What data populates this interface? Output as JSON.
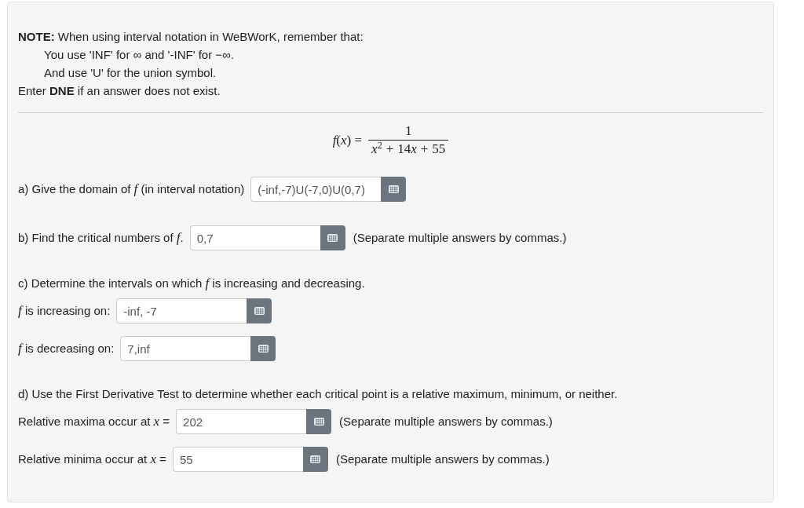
{
  "note": {
    "intro": "**NOTE:** When using interval notation in WeBWorK, remember that:",
    "items": [
      "You use 'INF' for ∞ and '-INF' for −∞.",
      "And use 'U' for the union symbol."
    ],
    "closing": "Enter **DNE** if an answer does not exist."
  },
  "formula": {
    "lhs": "*f*(*x*) =",
    "numerator": "1",
    "denominator": [
      {
        "kind": "variable",
        "text": "x",
        "exponent": "2"
      },
      {
        "kind": "operator",
        "text": "+"
      },
      {
        "kind": "number",
        "text": "14"
      },
      {
        "kind": "variable",
        "text": "x"
      },
      {
        "kind": "operator",
        "text": "+"
      },
      {
        "kind": "number",
        "text": "55"
      }
    ]
  },
  "parts": [
    {
      "fields": [
        {
          "label": "a) Give the domain of *f* (in interval notation)",
          "value": "(-inf,-7)U(-7,0)U(0,7)"
        }
      ]
    },
    {
      "fields": [
        {
          "label": "b) Find the critical numbers of *f*.",
          "value": "0,7",
          "hint": "(Separate multiple answers by commas.)"
        }
      ]
    },
    {
      "prompt": "c) Determine the intervals on which *f* is increasing and decreasing.",
      "fields": [
        {
          "label": "*f* is increasing on:",
          "value": "-inf, -7"
        },
        {
          "label": "*f* is decreasing on:",
          "value": "7,inf"
        }
      ]
    },
    {
      "prompt": "d) Use the First Derivative Test to determine whether each critical point is a relative maximum, minimum, or neither.",
      "fields": [
        {
          "label": "Relative maxima occur at *x* =",
          "value": "202",
          "hint": "(Separate multiple answers by commas.)"
        },
        {
          "label": "Relative minima occur at *x* =",
          "value": "55",
          "hint": "(Separate multiple answers by commas.)"
        }
      ]
    }
  ]
}
